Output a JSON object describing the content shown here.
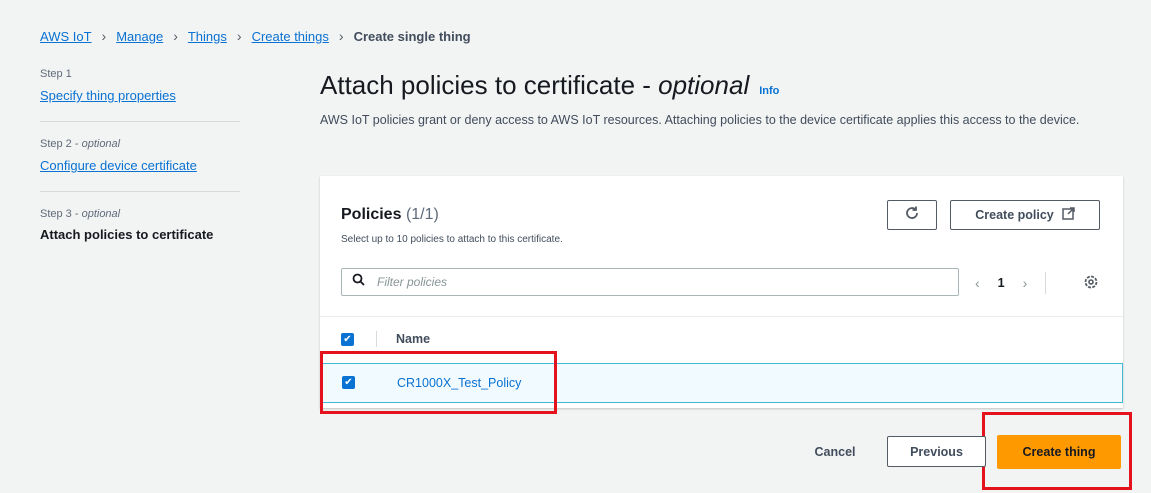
{
  "breadcrumb": {
    "items": [
      "AWS IoT",
      "Manage",
      "Things",
      "Create things"
    ],
    "current": "Create single thing"
  },
  "steps": [
    {
      "label": "Step 1",
      "optional": "",
      "title": "Specify thing properties"
    },
    {
      "label": "Step 2 - ",
      "optional": "optional",
      "title": "Configure device certificate"
    },
    {
      "label": "Step 3 - ",
      "optional": "optional",
      "title": "Attach policies to certificate"
    }
  ],
  "page": {
    "title": "Attach policies to certificate - ",
    "title_optional": "optional",
    "info": "Info",
    "description": "AWS IoT policies grant or deny access to AWS IoT resources. Attaching policies to the device certificate applies this access to the device."
  },
  "policies": {
    "title": "Policies",
    "count": "(1/1)",
    "subtitle": "Select up to 10 policies to attach to this certificate.",
    "create_policy": "Create policy",
    "search_placeholder": "Filter policies",
    "page": "1",
    "column_name": "Name",
    "rows": [
      {
        "name": "CR1000X_Test_Policy",
        "checked": true
      }
    ]
  },
  "footer": {
    "cancel": "Cancel",
    "previous": "Previous",
    "create": "Create thing"
  },
  "icons": {
    "refresh": "refresh-icon",
    "external": "external-link-icon",
    "search": "search-icon",
    "settings": "gear-icon"
  },
  "colors": {
    "link": "#0972d3",
    "primary_button": "#ff9900",
    "highlight": "#e3121c"
  }
}
